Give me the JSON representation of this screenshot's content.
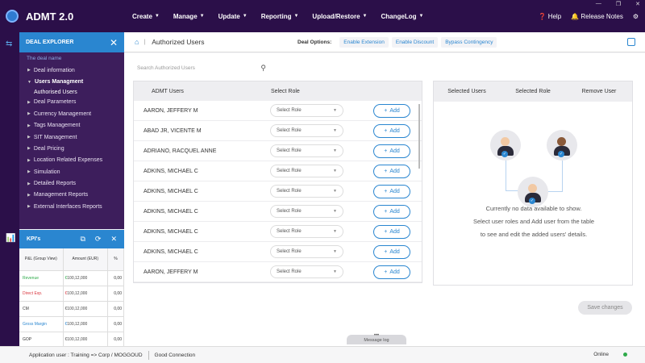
{
  "app": {
    "title": "ADMT 2.0"
  },
  "topnav": [
    {
      "label": "Create"
    },
    {
      "label": "Manage"
    },
    {
      "label": "Update"
    },
    {
      "label": "Reporting"
    },
    {
      "label": "Upload/Restore"
    },
    {
      "label": "ChangeLog"
    }
  ],
  "topright": {
    "help": "Help",
    "release_notes": "Release Notes"
  },
  "sidebar": {
    "title": "DEAL EXPLORER",
    "deal_name": "The deal name",
    "items": [
      {
        "label": "Deal information"
      },
      {
        "label": "Users Managment"
      },
      {
        "label": "Deal Parameters"
      },
      {
        "label": "Currency Management"
      },
      {
        "label": "Tags Management"
      },
      {
        "label": "SIT Management"
      },
      {
        "label": "Deal Pricing"
      },
      {
        "label": "Location Related Expenses"
      },
      {
        "label": "Simulation"
      },
      {
        "label": "Detailed Reports"
      },
      {
        "label": "Management Reports"
      },
      {
        "label": "External Interfaces Reports"
      }
    ],
    "subitem": "Authorised Users"
  },
  "kpi": {
    "title": "KPI's",
    "headers": [
      "P&L (Group View)",
      "Amount (EUR)",
      "%"
    ],
    "rows": [
      {
        "label": "Revenue",
        "amount": "100,12,000",
        "pct": "0,00",
        "color": "#2eaa4a"
      },
      {
        "label": "Direct Exp.",
        "amount": "100,12,000",
        "pct": "0,00",
        "color": "#d9363e"
      },
      {
        "label": "CM",
        "amount": "100,12,000",
        "pct": "0,00",
        "color": "#333333"
      },
      {
        "label": "Gross Margin",
        "amount": "100,12,000",
        "pct": "0,00",
        "color": "#2a86d0"
      },
      {
        "label": "GOP",
        "amount": "100,12,000",
        "pct": "0,00",
        "color": "#333333"
      }
    ]
  },
  "page": {
    "title": "Authorized Users",
    "deal_options_label": "Deal Options:",
    "deal_options": [
      "Enable Extension",
      "Enable Discount",
      "Bypass Contingency"
    ]
  },
  "search": {
    "placeholder": "Search Authorized Users"
  },
  "users_table": {
    "headers": [
      "ADMT Users",
      "Select Role"
    ],
    "select_placeholder": "Select Role",
    "add_label": "Add",
    "rows": [
      "AARON, JEFFERY M",
      "ABAD JR, VICENTE M",
      "ADRIANO, RACQUEL ANNE",
      "ADKINS, MICHAEL C",
      "ADKINS, MICHAEL C",
      "ADKINS, MICHAEL C",
      "ADKINS, MICHAEL C",
      "ADKINS, MICHAEL C",
      "AARON, JEFFERY M"
    ]
  },
  "selected_panel": {
    "headers": [
      "Selected Users",
      "Selected Role",
      "Remove User"
    ],
    "empty_lines": [
      "Currently no data available to show.",
      "Select user roles and Add user from the table",
      "to see and edit the added users' details."
    ]
  },
  "save_button": "Save changes",
  "message_log": "Message log",
  "status": {
    "user": "Application user : Training => Corp / MOGGOUD",
    "connection": "Good Connection",
    "online": "Online"
  }
}
